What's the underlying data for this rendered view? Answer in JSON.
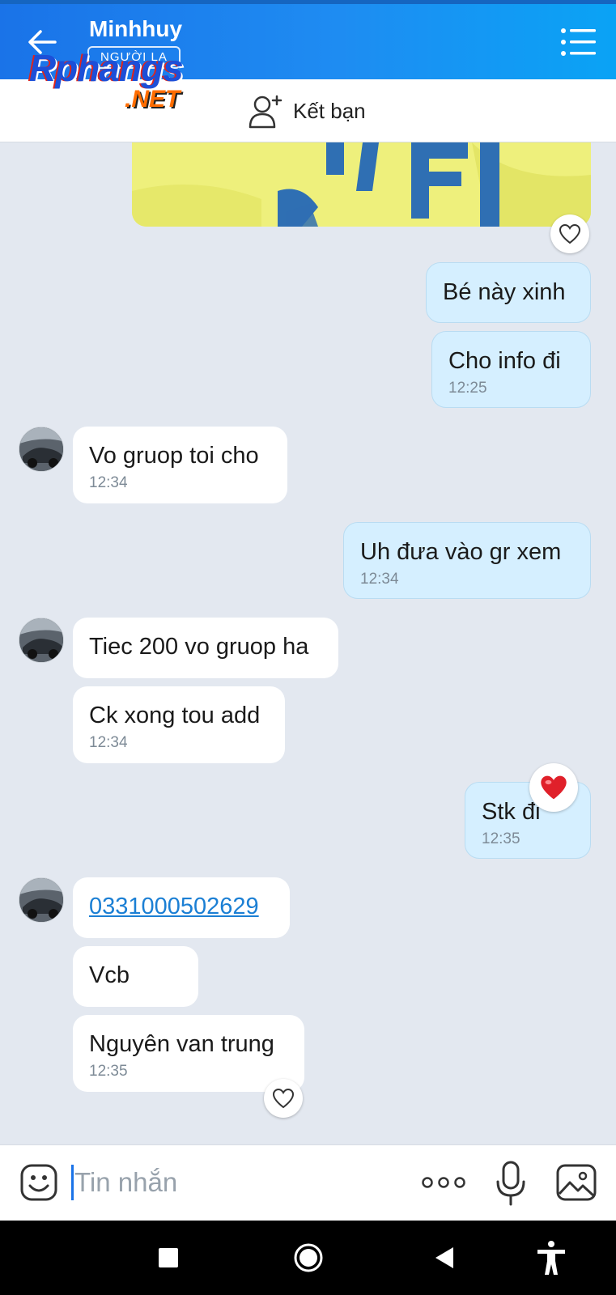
{
  "header": {
    "title": "Minhhuy",
    "subtitle": "NGƯỜI LẠ",
    "back_icon": "arrow-left-icon",
    "menu_icon": "list-menu-icon",
    "color": "#1e8cf2"
  },
  "watermark": {
    "main": "Rphangs",
    "suffix": ".NET"
  },
  "friend_bar": {
    "label": "Kết bạn",
    "icon": "add-friend-icon"
  },
  "messages": [
    {
      "dir": "out",
      "text": "Bé này xinh",
      "time": ""
    },
    {
      "dir": "out",
      "text": "Cho info đi",
      "time": "12:25"
    },
    {
      "dir": "in",
      "text": "Vo gruop toi cho",
      "time": "12:34"
    },
    {
      "dir": "out",
      "text": "Uh đưa vào gr xem",
      "time": "12:34"
    },
    {
      "dir": "in",
      "text": "Tiec 200 vo gruop ha",
      "time": ""
    },
    {
      "dir": "in",
      "text": "Ck xong tou add",
      "time": "12:34"
    },
    {
      "dir": "out",
      "text": "Stk đi",
      "time": "12:35"
    },
    {
      "dir": "in",
      "text": "0331000502629",
      "time": ""
    },
    {
      "dir": "in",
      "text": "Vcb",
      "time": ""
    },
    {
      "dir": "in",
      "text": "Nguyên van trung",
      "time": "12:35"
    }
  ],
  "composer": {
    "placeholder": "Tin nhắn",
    "emoji_icon": "sticker-icon",
    "more_icon": "more-dots-icon",
    "mic_icon": "microphone-icon",
    "image_icon": "image-icon"
  },
  "navbar": [
    "square-icon",
    "home-circle-icon",
    "back-triangle-icon",
    "accessibility-icon"
  ],
  "colors": {
    "outgoing_bubble": "#d5efff",
    "incoming_bubble": "#ffffff",
    "background": "#e3e8f0",
    "heart": "#e0202a"
  }
}
